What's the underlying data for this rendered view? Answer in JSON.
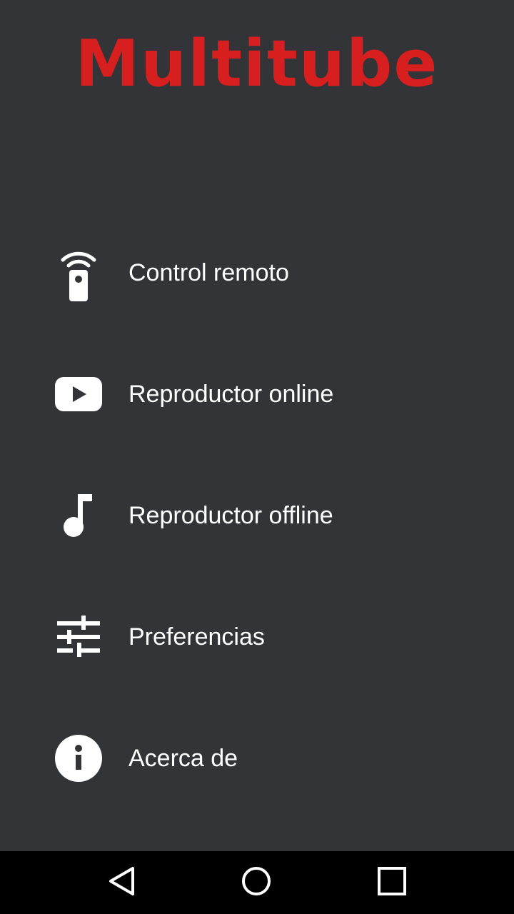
{
  "app": {
    "logo_text": "Multitube",
    "brand_color": "#d81f1f",
    "background_color": "#323437"
  },
  "menu": {
    "items": [
      {
        "label": "Control remoto",
        "icon": "remote-control-icon"
      },
      {
        "label": "Reproductor online",
        "icon": "youtube-play-icon"
      },
      {
        "label": "Reproductor offline",
        "icon": "music-note-icon"
      },
      {
        "label": "Preferencias",
        "icon": "tune-sliders-icon"
      },
      {
        "label": "Acerca de",
        "icon": "info-icon"
      }
    ]
  },
  "navbar": {
    "buttons": [
      {
        "icon": "back-triangle-icon"
      },
      {
        "icon": "home-circle-icon"
      },
      {
        "icon": "recents-square-icon"
      }
    ]
  }
}
